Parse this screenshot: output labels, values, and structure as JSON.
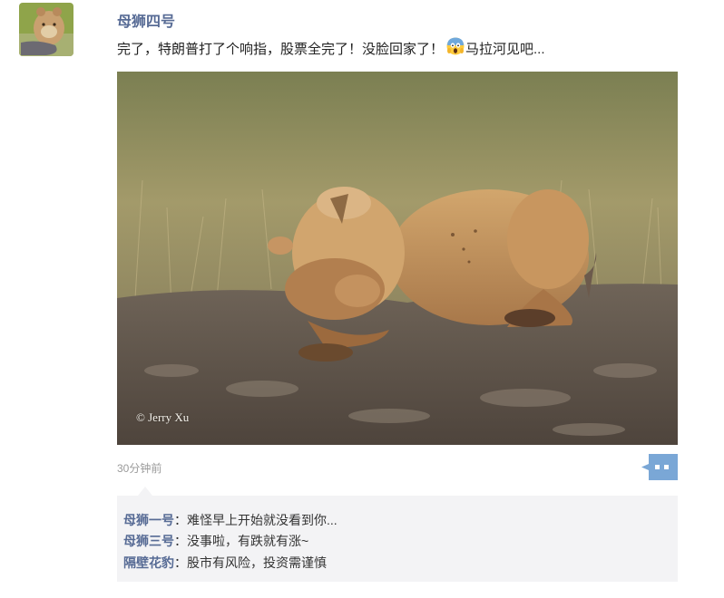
{
  "post": {
    "author_name": "母狮四号",
    "text_part1": "完了，特朗普打了个响指，股票全完了！没脸回家了！",
    "emoji_icon": "scream-emoji-icon",
    "text_part2": "马拉河见吧...",
    "photo_watermark": "© Jerry Xu",
    "timestamp": "30分钟前"
  },
  "comments": [
    {
      "author": "母狮一号",
      "sep": "：",
      "text": "难怪早上开始就没看到你..."
    },
    {
      "author": "母狮三号",
      "sep": "：",
      "text": "没事啦，有跌就有涨~"
    },
    {
      "author": "隔壁花豹",
      "sep": "：",
      "text": "股市有风险，投资需谨慎"
    }
  ],
  "colors": {
    "author_blue": "#576b95",
    "comment_bg": "#f3f3f5",
    "comment_button": "#7aa7d6"
  }
}
